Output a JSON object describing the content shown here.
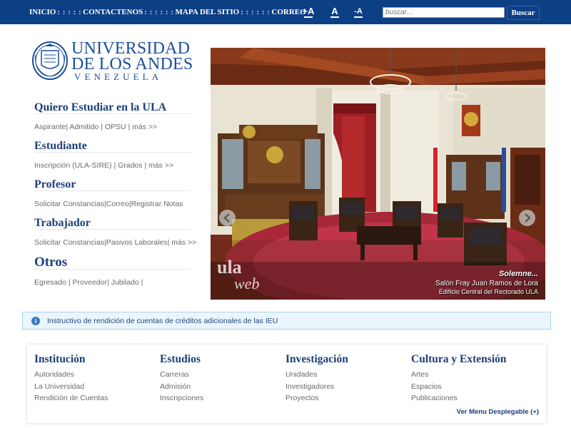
{
  "topbar": {
    "nav": [
      "INICIO",
      "CONTACTENOS",
      "MAPA DEL SITIO",
      "CORREO"
    ],
    "separator": ": : : : :",
    "separator_long": ": : : : : :",
    "font_controls": [
      {
        "label": "+A",
        "icon": "font-increase-icon"
      },
      {
        "label": "A",
        "icon": "font-reset-icon"
      },
      {
        "label": "-A",
        "icon": "font-decrease-icon"
      }
    ],
    "search_placeholder": "buscar...",
    "search_button": "Buscar"
  },
  "logo": {
    "line1": "UNIVERSIDAD",
    "line2": "DE LOS ANDES",
    "line3": "VENEZUELA",
    "seal_icon": "university-seal-icon"
  },
  "menu": [
    {
      "title": "Quiero Estudiar en la ULA",
      "links": "Aspirante| Admitido | OPSU | más >>"
    },
    {
      "title": "Estudiante",
      "links": "Inscripción (ULA-SIRE) | Grados | más >>"
    },
    {
      "title": "Profesor",
      "links": "Solicitar Constancias|Correo|Registrar Notas"
    },
    {
      "title": "Trabajador",
      "links": "Solicitar Constancias|Pasivos Laborales| más >>"
    },
    {
      "title": "Otros",
      "links": "Egresado | Proveedor| Jubilado |"
    }
  ],
  "slideshow": {
    "caption_title": "Solemne...",
    "caption_line1": "Salón Fray Juan Ramos de Lora",
    "caption_line2": "Edificio Central del Rectorado ULA",
    "watermark_line1": "ula",
    "watermark_line2": "web",
    "prev_icon": "chevron-left-icon",
    "next_icon": "chevron-right-icon"
  },
  "notice": {
    "icon": "info-icon",
    "text": "Instructivo de rendición de cuentas de créditos adicionales de las IEU"
  },
  "footer": {
    "columns": [
      {
        "title": "Institución",
        "links": [
          "Autoridades",
          "La Universidad",
          "Rendición de Cuentas"
        ]
      },
      {
        "title": "Estudios",
        "links": [
          "Carreras",
          "Admisión",
          "Inscripciones"
        ]
      },
      {
        "title": "Investigación",
        "links": [
          "Unidades",
          "Investigadores",
          "Proyectos"
        ]
      },
      {
        "title": "Cultura y Extensión",
        "links": [
          "Artes",
          "Espacios",
          "Publicaciones"
        ]
      }
    ],
    "more_menu": "Ver Menu Desplegable (+)"
  },
  "colors": {
    "brand_blue": "#0d3f85",
    "title_blue": "#1a3f7a",
    "notice_bg": "#eaf5fc"
  }
}
